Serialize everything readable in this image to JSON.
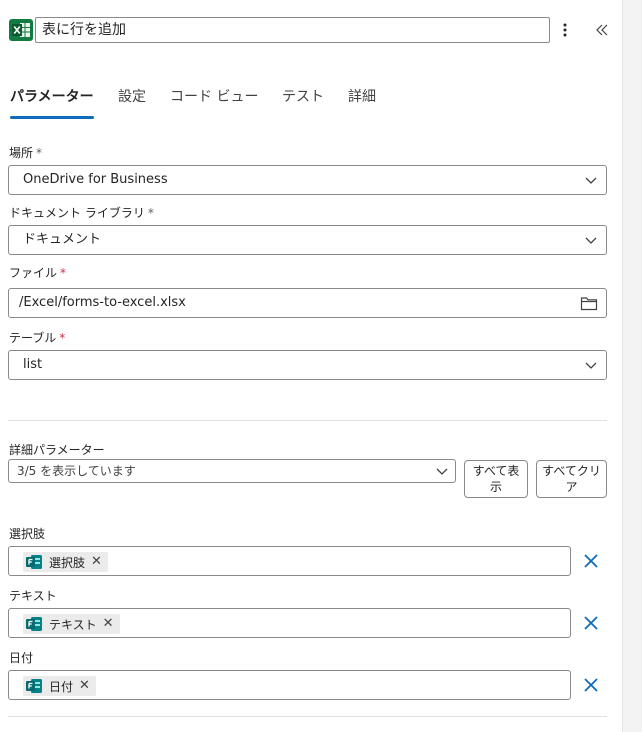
{
  "header": {
    "title": "表に行を追加",
    "colors": {
      "excel_green": "#107c41",
      "accent": "#0f6cbd"
    }
  },
  "tabs": [
    {
      "label": "パラメーター",
      "active": true
    },
    {
      "label": "設定"
    },
    {
      "label": "コード ビュー"
    },
    {
      "label": "テスト"
    },
    {
      "label": "詳細"
    }
  ],
  "fields": {
    "location": {
      "label": "場所",
      "required_mark": "*",
      "value": "OneDrive for Business"
    },
    "library": {
      "label": "ドキュメント ライブラリ",
      "required_mark": "*",
      "value": "ドキュメント"
    },
    "file": {
      "label": "ファイル",
      "required_mark": "*",
      "value": "/Excel/forms-to-excel.xlsx"
    },
    "table": {
      "label": "テーブル",
      "required_mark": "*",
      "value": "list"
    }
  },
  "advanced": {
    "label": "詳細パラメーター",
    "selector_value": "3/5 を表示しています",
    "show_all_label": "すべて表示",
    "clear_all_label": "すべてクリア"
  },
  "params": [
    {
      "label": "選択肢",
      "token": "選択肢"
    },
    {
      "label": "テキスト",
      "token": "テキスト"
    },
    {
      "label": "日付",
      "token": "日付"
    }
  ],
  "icons": {
    "app": "excel-icon",
    "more": "more-vertical-icon",
    "collapse": "double-chevron-left-icon",
    "dropdown": "chevron-down-icon",
    "folder": "folder-icon",
    "token": "forms-icon",
    "remove": "close-icon"
  }
}
